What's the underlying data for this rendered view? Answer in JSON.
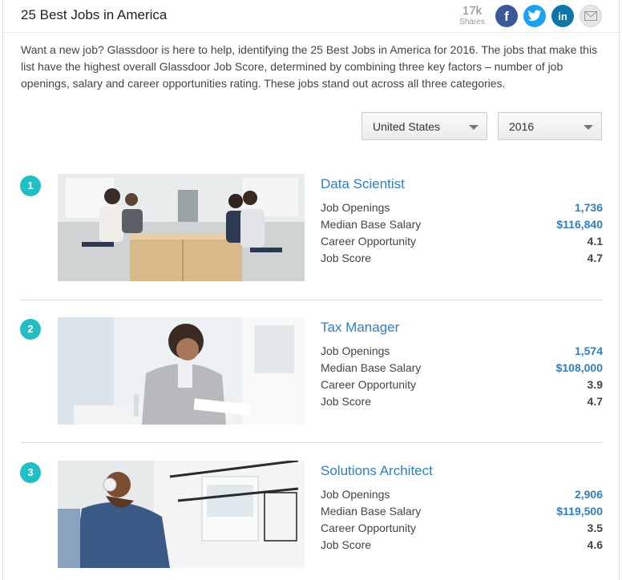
{
  "header": {
    "title": "25 Best Jobs in America",
    "shares_count": "17k",
    "shares_label": "Shares",
    "social": [
      {
        "name": "facebook-icon",
        "glyph": "f",
        "color": "#3b5998"
      },
      {
        "name": "twitter-icon",
        "glyph": "",
        "color": "#1da1f2"
      },
      {
        "name": "linkedin-icon",
        "glyph": "in",
        "color": "#0e76a8"
      },
      {
        "name": "email-icon",
        "glyph": "",
        "color": "#e6e6e6"
      }
    ]
  },
  "intro": "Want a new job? Glassdoor is here to help, identifying the 25 Best Jobs in America for 2016. The jobs that make this list have the highest overall Glassdoor Job Score, determined by combining three key factors – number of job openings, salary and career opportunities rating. These jobs stand out across all three categories.",
  "filters": {
    "country": "United States",
    "year": "2016"
  },
  "stat_labels": {
    "openings": "Job Openings",
    "salary": "Median Base Salary",
    "career": "Career Opportunity",
    "score": "Job Score"
  },
  "jobs": [
    {
      "rank": "1",
      "title": "Data Scientist",
      "openings": "1,736",
      "salary": "$116,840",
      "career": "4.1",
      "score": "4.7"
    },
    {
      "rank": "2",
      "title": "Tax Manager",
      "openings": "1,574",
      "salary": "$108,000",
      "career": "3.9",
      "score": "4.7"
    },
    {
      "rank": "3",
      "title": "Solutions Architect",
      "openings": "2,906",
      "salary": "$119,500",
      "career": "3.5",
      "score": "4.6"
    }
  ],
  "colors": {
    "accent_blue": "#2f7ec1",
    "rank_teal": "#20bfc6"
  }
}
